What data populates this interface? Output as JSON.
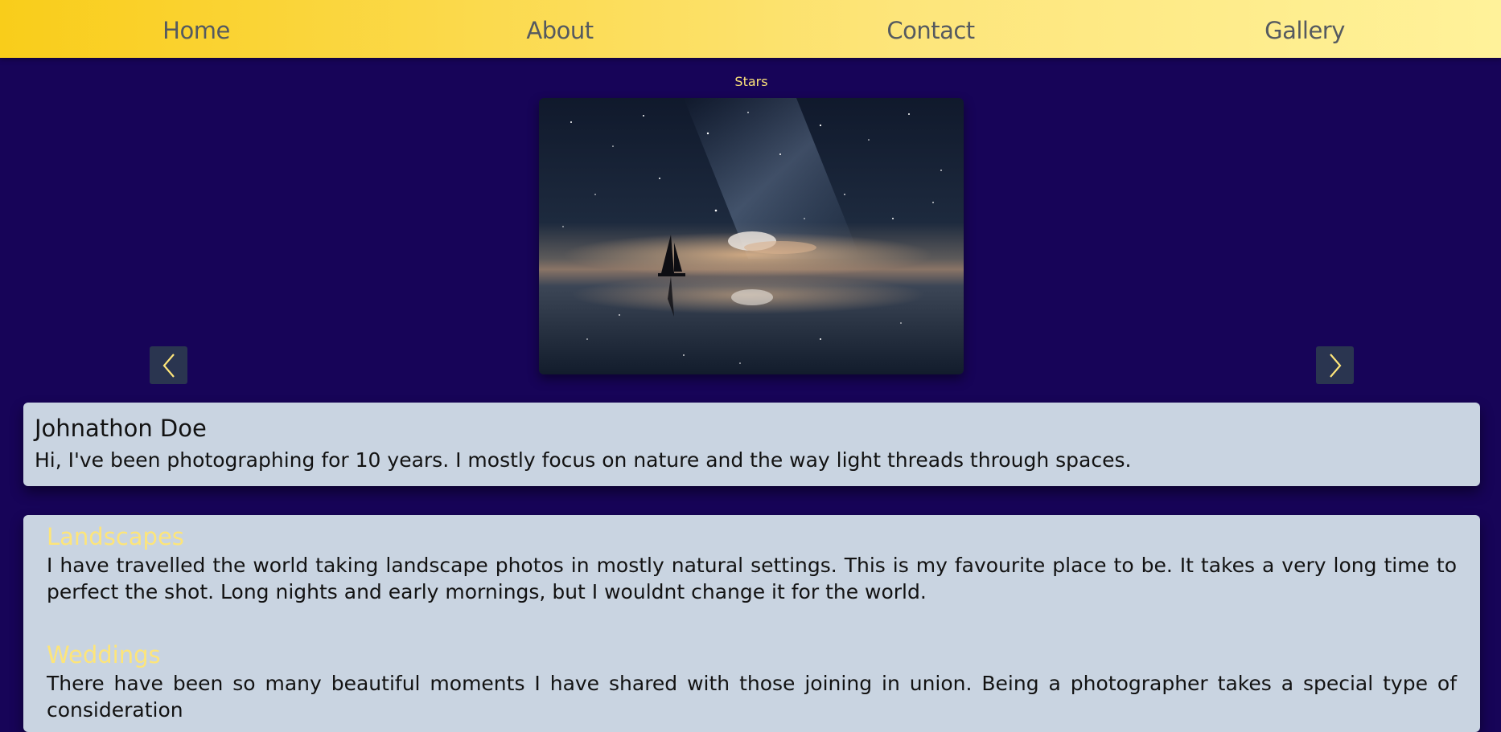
{
  "nav": {
    "items": [
      {
        "label": "Home"
      },
      {
        "label": "About"
      },
      {
        "label": "Contact"
      },
      {
        "label": "Gallery"
      }
    ]
  },
  "carousel": {
    "caption": "Stars",
    "image_icon": "night-sky-sailboat-photo",
    "prev_icon": "chevron-left-icon",
    "next_icon": "chevron-right-icon"
  },
  "bio": {
    "name": "Johnathon Doe",
    "text": "Hi, I've been photographing for 10 years. I mostly focus on nature and the way light threads through spaces."
  },
  "services": [
    {
      "title": "Landscapes",
      "text": "I have travelled the world taking landscape photos in mostly natural settings. This is my favourite place to be. It takes a very long time to perfect the shot. Long nights and early mornings, but I wouldnt change it for the world."
    },
    {
      "title": "Weddings",
      "text": "There have been so many beautiful moments I have shared with those joining in union. Being a photographer takes a special type of consideration"
    }
  ],
  "colors": {
    "background": "#170458",
    "nav_gradient_start": "#f9cd1a",
    "nav_gradient_end": "#fff29a",
    "accent_yellow": "#fde57a",
    "card": "#c9d4e1",
    "arrow_button": "#2a3550"
  }
}
